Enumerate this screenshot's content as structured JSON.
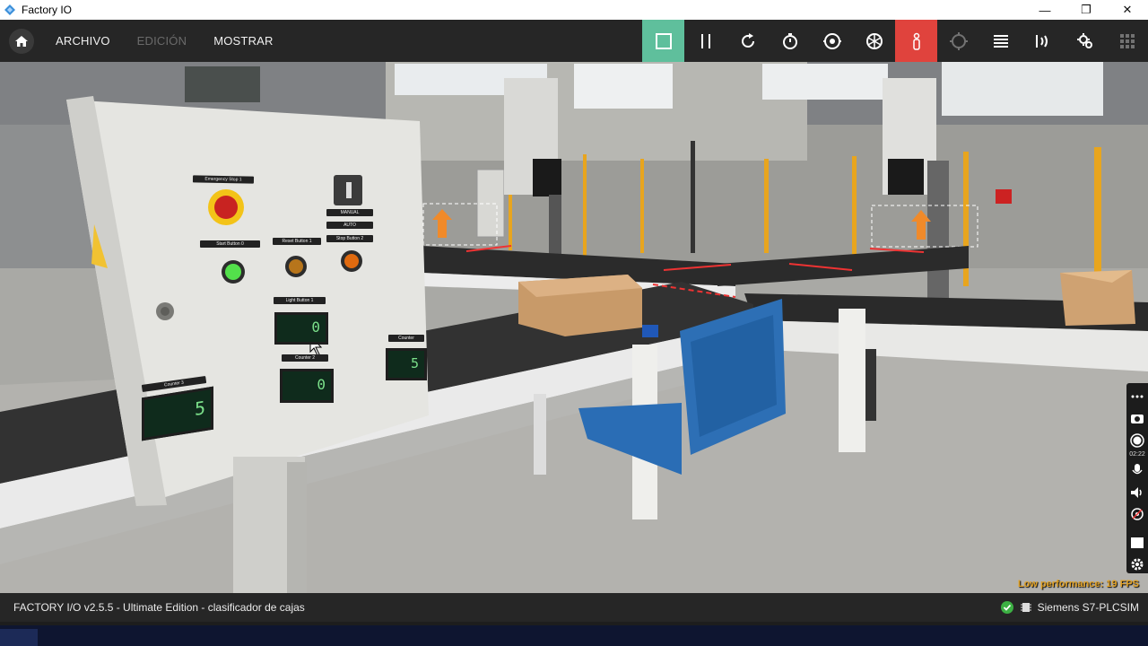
{
  "window": {
    "title": "Factory IO",
    "minimize": "—",
    "restore": "❐",
    "close": "✕"
  },
  "menu": {
    "items": [
      {
        "label": "ARCHIVO",
        "enabled": true
      },
      {
        "label": "EDICIÓN",
        "enabled": false
      },
      {
        "label": "MOSTRAR",
        "enabled": true
      }
    ]
  },
  "toolbar": {
    "buttons": [
      {
        "icon": "stop-icon",
        "state": "active",
        "color": "#5fbf9c"
      },
      {
        "icon": "pause-icon"
      },
      {
        "icon": "reset-icon"
      },
      {
        "icon": "timer-icon"
      },
      {
        "icon": "camera-orbit-icon"
      },
      {
        "icon": "fly-camera-icon"
      },
      {
        "icon": "first-person-icon",
        "state": "active",
        "color": "#e0433d"
      },
      {
        "icon": "target-icon",
        "state": "dim"
      },
      {
        "icon": "list-icon"
      },
      {
        "icon": "sensor-icon"
      },
      {
        "icon": "drivers-icon"
      },
      {
        "icon": "grid-icon",
        "state": "dim"
      }
    ]
  },
  "scene": {
    "performance": "Low performance: 19 FPS",
    "control_panel": {
      "emergency_label": "Emergency Stop 1",
      "start_label": "Start Button 0",
      "reset_label": "Reset Button 1",
      "stop_label": "Stop Button 2",
      "selector_labels": [
        "MANUAL",
        "AUTO",
        "Stop Button 2"
      ],
      "display_label_top": "Light Button 1",
      "display_label_mid": "Counter 2",
      "display_label_left": "Counter 3",
      "display_label_right": "Counter",
      "display_top_value": "0",
      "display_mid_value": "0",
      "display_left_value": "5",
      "display_right_value": "5"
    },
    "record_time": "02:22"
  },
  "status": {
    "left": "FACTORY I/O v2.5.5 - Ultimate Edition - clasificador de cajas",
    "right": "Siemens S7-PLCSIM",
    "connection_color": "#3cb043"
  }
}
